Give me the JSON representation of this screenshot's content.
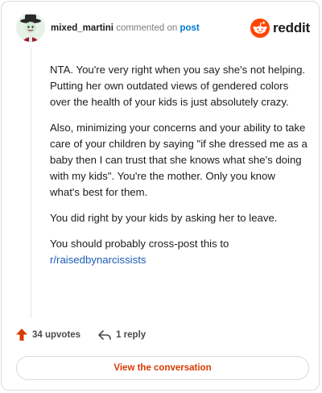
{
  "comment": {
    "username": "mixed_martini",
    "action_text": "commented on",
    "target_text": "post",
    "paragraphs": [
      "NTA. You're very right when you say she's not helping. Putting her own outdated views of gendered colors over the health of your kids is just absolutely crazy.",
      "Also, minimizing your concerns and your ability to take care of your children by saying \"if she dressed me as a baby then I can trust that she knows what she's doing with my kids\". You're the mother. Only you know what's best for them.",
      "You did right by your kids by asking her to leave."
    ],
    "last_paragraph_text": "You should probably cross-post this to",
    "subreddit_link": "r/raisedbynarcissists"
  },
  "brand": {
    "name": "reddit",
    "color": "#ff4500"
  },
  "actions": {
    "upvotes_label": "34 upvotes",
    "replies_label": "1 reply"
  },
  "footer": {
    "button_label": "View the conversation",
    "button_color": "#d93a00"
  }
}
